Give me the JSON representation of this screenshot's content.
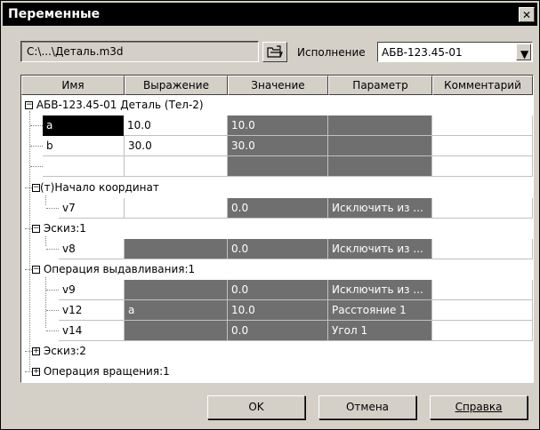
{
  "window": {
    "title": "Переменные",
    "close_glyph": "✕"
  },
  "toolbar": {
    "path": "C:\\...\\Деталь.m3d",
    "ispolnenie_label": "Исполнение",
    "ispolnenie_value": "АБВ-123.45-01"
  },
  "table": {
    "columns": [
      "Имя",
      "Выражение",
      "Значение",
      "Параметр",
      "Комментарий"
    ],
    "groups": {
      "root": "АБВ-123.45-01 Деталь (Тел-2)",
      "origin": "(т)Начало координат",
      "sketch1": "Эскиз:1",
      "extrude": "Операция выдавливания:1",
      "sketch2": "Эскиз:2",
      "rotate": "Операция вращения:1"
    },
    "rows": [
      {
        "name": "a",
        "expr": "10.0",
        "value": "10.0",
        "param": "",
        "comment": ""
      },
      {
        "name": "b",
        "expr": "30.0",
        "value": "30.0",
        "param": "",
        "comment": ""
      },
      {
        "name": "",
        "expr": "",
        "value": "",
        "param": "",
        "comment": ""
      },
      {
        "name": "v7",
        "expr": "",
        "value": "0.0",
        "param": "Исключить из ...",
        "comment": ""
      },
      {
        "name": "v8",
        "expr": "",
        "value": "0.0",
        "param": "Исключить из ...",
        "comment": ""
      },
      {
        "name": "v9",
        "expr": "",
        "value": "0.0",
        "param": "Исключить из ...",
        "comment": ""
      },
      {
        "name": "v12",
        "expr": "a",
        "value": "10.0",
        "param": "Расстояние 1",
        "comment": ""
      },
      {
        "name": "v14",
        "expr": "",
        "value": "0.0",
        "param": "Угол 1",
        "comment": ""
      }
    ]
  },
  "buttons": {
    "ok": "OK",
    "cancel": "Отмена",
    "help": "Справка"
  }
}
